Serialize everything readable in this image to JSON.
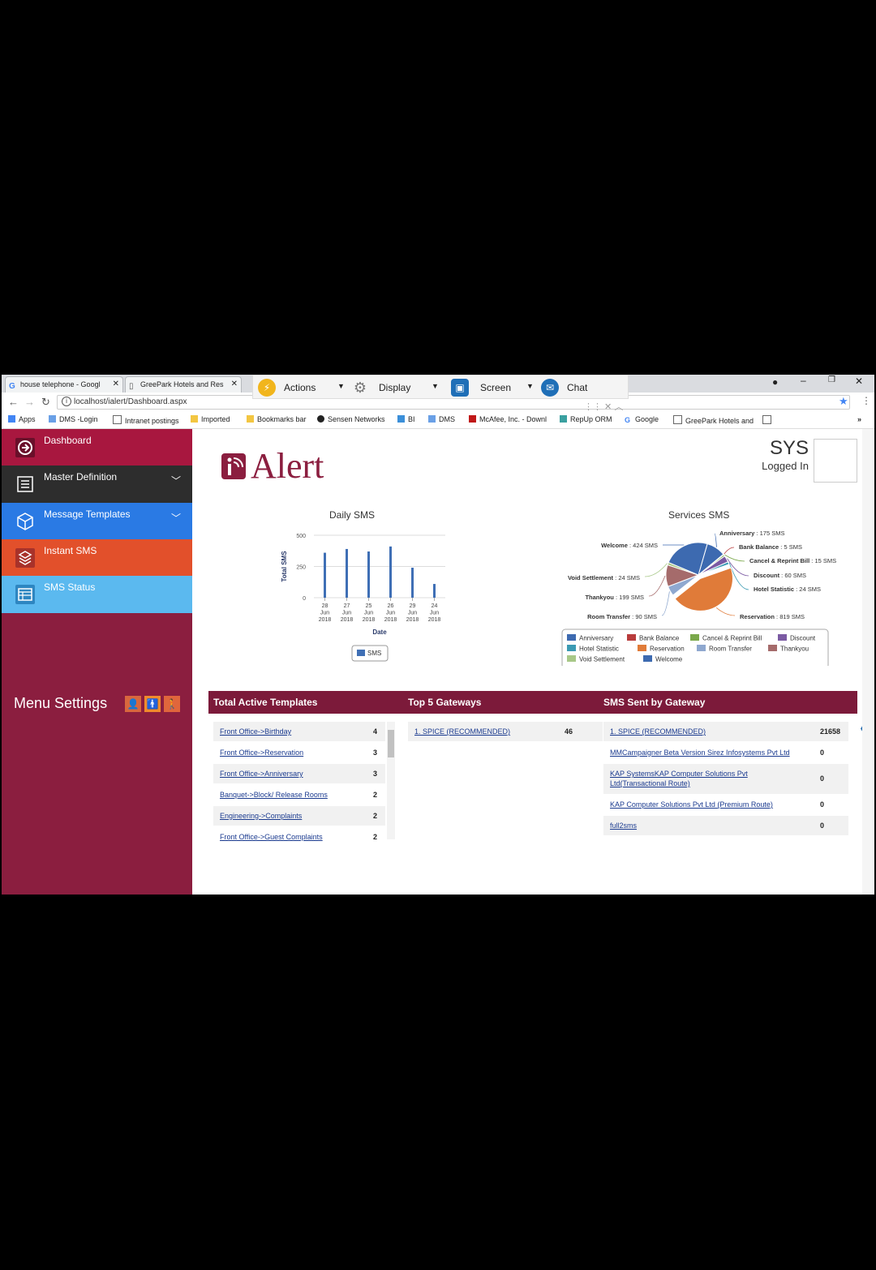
{
  "browser": {
    "tabs": [
      {
        "label": "house telephone - Googl",
        "icon": "google-icon"
      },
      {
        "label": "GreePark Hotels and Res",
        "icon": "page-icon"
      }
    ],
    "url": "localhost/ialert/Dashboard.aspx",
    "bookmarks": [
      "Apps",
      "DMS -Login",
      "Intranet postings",
      "Imported",
      "Bookmarks bar",
      "Sensen Networks",
      "BI",
      "DMS",
      "McAfee, Inc. - Downl",
      "RepUp ORM",
      "Google",
      "GreePark Hotels and"
    ]
  },
  "remote_toolbar": {
    "items": [
      "Actions",
      "Display",
      "Screen",
      "Chat"
    ]
  },
  "sidebar": {
    "items": [
      {
        "label": "Dashboard",
        "color": "#a8173f"
      },
      {
        "label": "Master Definition",
        "color": "#2d2d2d"
      },
      {
        "label": "Message Templates",
        "color": "#2a7ae4"
      },
      {
        "label": "Instant SMS",
        "color": "#e2502b"
      },
      {
        "label": "SMS Status",
        "color": "#5bb9ef"
      }
    ],
    "menu_settings": "Menu Settings"
  },
  "header": {
    "logo_text": "Alert",
    "user": "SYS",
    "user_status": "Logged In"
  },
  "chart_data": [
    {
      "type": "bar",
      "title": "Daily SMS",
      "xlabel": "Date",
      "ylabel": "Total SMS",
      "ylim": [
        0,
        500
      ],
      "yticks": [
        0,
        250,
        500
      ],
      "categories": [
        [
          "28",
          "Jun",
          "2018"
        ],
        [
          "27",
          "Jun",
          "2018"
        ],
        [
          "25",
          "Jun",
          "2018"
        ],
        [
          "26",
          "Jun",
          "2018"
        ],
        [
          "29",
          "Jun",
          "2018"
        ],
        [
          "24",
          "Jun",
          "2018"
        ]
      ],
      "series": [
        {
          "name": "SMS",
          "values": [
            360,
            390,
            370,
            410,
            240,
            110
          ],
          "color": "#3f6fb5"
        }
      ],
      "legend": "bottom-center"
    },
    {
      "type": "pie",
      "title": "Services SMS",
      "unit": "SMS",
      "slices": [
        {
          "name": "Anniversary",
          "value": 175,
          "color": "#3d6ab0"
        },
        {
          "name": "Bank Balance",
          "value": 5,
          "color": "#b83c3c"
        },
        {
          "name": "Cancel & Reprint Bill",
          "value": 15,
          "color": "#7aa84b"
        },
        {
          "name": "Discount",
          "value": 60,
          "color": "#7b5aa3"
        },
        {
          "name": "Hotel Statistic",
          "value": 24,
          "color": "#3b9ab3"
        },
        {
          "name": "Reservation",
          "value": 819,
          "color": "#e07b39"
        },
        {
          "name": "Room Transfer",
          "value": 90,
          "color": "#8fa8cf"
        },
        {
          "name": "Thankyou",
          "value": 199,
          "color": "#a56b6b"
        },
        {
          "name": "Void Settlement",
          "value": 24,
          "color": "#a8c888"
        },
        {
          "name": "Welcome",
          "value": 424,
          "color": "#3d6ab0"
        }
      ],
      "legend": "bottom"
    }
  ],
  "panels": {
    "templates_title": "Total Active Templates",
    "gateways_title": "Top 5 Gateways",
    "sent_title": "SMS Sent by Gateway",
    "templates": [
      {
        "name": "Front Office->Birthday",
        "count": "4"
      },
      {
        "name": "Front Office->Reservation",
        "count": "3"
      },
      {
        "name": "Front Office->Anniversary",
        "count": "3"
      },
      {
        "name": "Banquet->Block/ Release Rooms",
        "count": "2"
      },
      {
        "name": "Engineering->Complaints",
        "count": "2"
      },
      {
        "name": "Front Office->Guest Complaints",
        "count": "2"
      }
    ],
    "gateways": [
      {
        "name": "1. SPICE (RECOMMENDED)",
        "count": "46"
      }
    ],
    "sent": [
      {
        "name": "1. SPICE (RECOMMENDED)",
        "count": "21658"
      },
      {
        "name": "MMCampaigner Beta Version Sirez Infosystems Pvt Ltd",
        "count": "0"
      },
      {
        "name": "KAP SystemsKAP Computer Solutions Pvt",
        "name2": "Ltd(Transactional Route)",
        "count": "0"
      },
      {
        "name": "KAP Computer Solutions Pvt Ltd (Premium Route)",
        "count": "0"
      },
      {
        "name": "full2sms",
        "count": "0"
      }
    ]
  }
}
